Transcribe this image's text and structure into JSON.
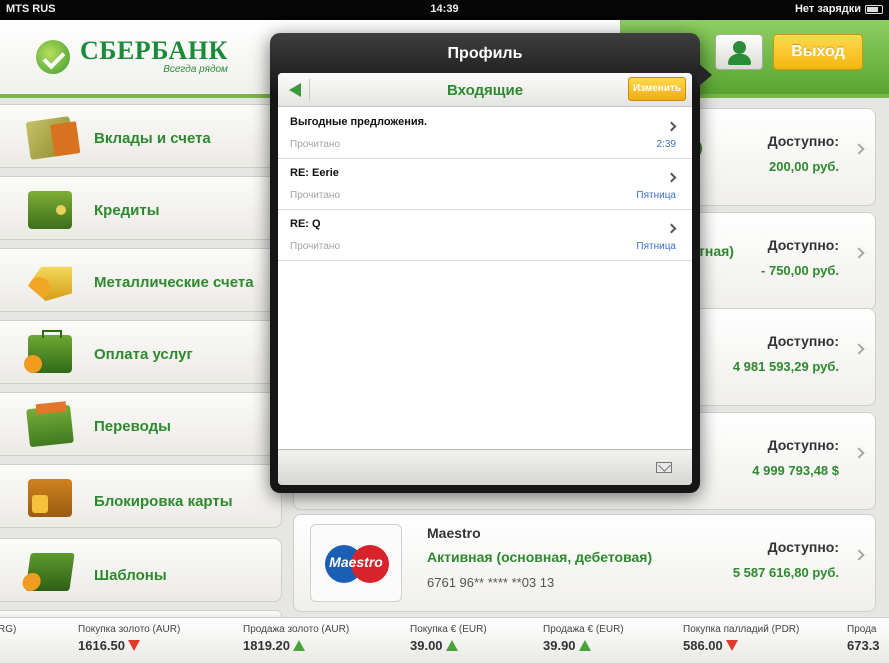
{
  "status_bar": {
    "carrier": "MTS RUS",
    "time": "14:39",
    "battery_text": "Нет зарядки"
  },
  "header": {
    "bank_name": "СБЕРБАНК",
    "slogan": "Всегда рядом",
    "exit_label": "Выход"
  },
  "menu": {
    "items": [
      {
        "label": "Вклады и счета",
        "icon": "money-icon"
      },
      {
        "label": "Кредиты",
        "icon": "wallet-icon"
      },
      {
        "label": "Металлические счета",
        "icon": "gold-icon"
      },
      {
        "label": "Оплата услуг",
        "icon": "briefcase-icon"
      },
      {
        "label": "Переводы",
        "icon": "transfer-icon"
      },
      {
        "label": "Блокировка карты",
        "icon": "lock-icon"
      },
      {
        "label": "Шаблоны",
        "icon": "folder-icon"
      }
    ]
  },
  "accounts": [
    {
      "partial": ")",
      "available_label": "Доступно:",
      "amount": "200,00 руб."
    },
    {
      "partial": "тная)",
      "available_label": "Доступно:",
      "amount": "- 750,00 руб."
    },
    {
      "partial": "",
      "available_label": "Доступно:",
      "amount": "4 981 593,29 руб."
    },
    {
      "partial": "",
      "available_label": "Доступно:",
      "amount": "4 999 793,48 $"
    },
    {
      "name": "Maestro",
      "status": "Активная (основная, дебетовая)",
      "number": "6761 96** **** **03 13",
      "available_label": "Доступно:",
      "amount": "5 587 616,80 руб.",
      "logo_text": "Maestro"
    }
  ],
  "popover": {
    "title": "Профиль",
    "inbox_title": "Входящие",
    "edit_label": "Изменить",
    "messages": [
      {
        "subject": "Выгодные предложения.",
        "status": "Прочитано",
        "date": "2:39"
      },
      {
        "subject": "RE: Eerie",
        "status": "Прочитано",
        "date": "Пятница"
      },
      {
        "subject": "RE: Q",
        "status": "Прочитано",
        "date": "Пятница"
      }
    ]
  },
  "ticker": [
    {
      "label": "RG)",
      "value": ""
    },
    {
      "label": "Покупка золото (AUR)",
      "value": "1616.50",
      "trend": "down"
    },
    {
      "label": "Продажа золото (AUR)",
      "value": "1819.20",
      "trend": "up"
    },
    {
      "label": "Покупка € (EUR)",
      "value": "39.00",
      "trend": "up"
    },
    {
      "label": "Продажа € (EUR)",
      "value": "39.90",
      "trend": "up"
    },
    {
      "label": "Покупка палладий (PDR)",
      "value": "586.00",
      "trend": "down"
    },
    {
      "label": "Прода",
      "value": "673.3"
    }
  ],
  "colors": {
    "brand_green": "#2e8a2e",
    "accent_yellow": "#f4b711",
    "up": "#4aa23a",
    "down": "#e23a2a"
  }
}
